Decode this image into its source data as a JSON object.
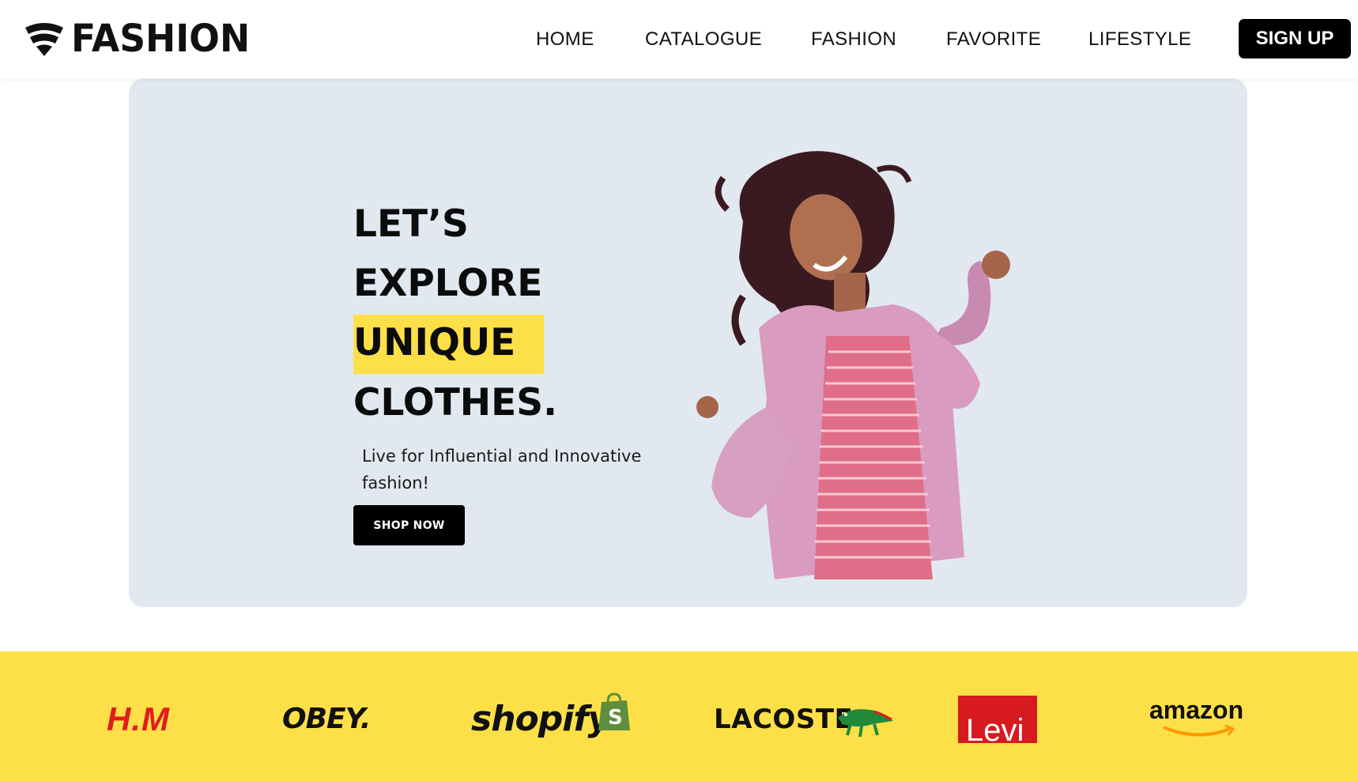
{
  "nav": {
    "brand": "FASHION",
    "links": [
      "HOME",
      "CATALOGUE",
      "FASHION",
      "FAVORITE",
      "LIFESTYLE"
    ],
    "signup_label": "SIGN UP"
  },
  "hero": {
    "headline": [
      "LET’S",
      "EXPLORE",
      "UNIQUE",
      "CLOTHES."
    ],
    "highlight_word": "UNIQUE",
    "highlight_color": "#fde047",
    "subtext": "Live for Influential and Innovative fashion!",
    "cta_label": "SHOP NOW",
    "background": "#e2e8f0",
    "image": "woman-in-pink-fur-coat-dancing"
  },
  "brands": {
    "background": "#fde047",
    "logos": [
      "H.M",
      "OBEY.",
      "shopify",
      "LACOSTE",
      "Levi",
      "amazon"
    ]
  },
  "colors": {
    "accent": "#fde047",
    "button": "#000000",
    "hm_red": "#e11d1d",
    "levis_red": "#d71920"
  }
}
